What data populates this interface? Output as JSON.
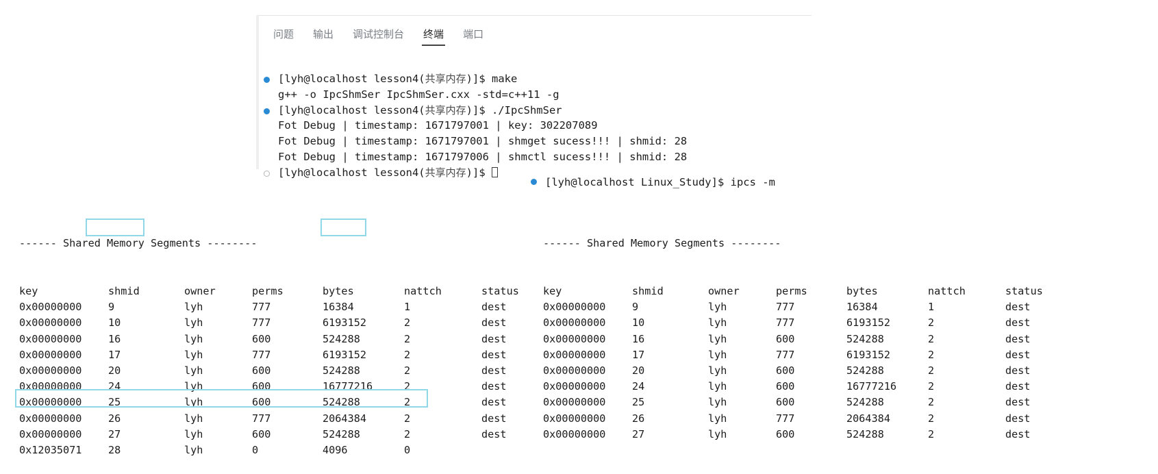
{
  "tabs": [
    {
      "label": "问题",
      "active": false
    },
    {
      "label": "输出",
      "active": false
    },
    {
      "label": "调试控制台",
      "active": false
    },
    {
      "label": "终端",
      "active": true
    },
    {
      "label": "端口",
      "active": false
    }
  ],
  "terminal": {
    "prompt_user_host": "[lyh@localhost ",
    "prompt_dir_1": "lesson4(共享内存)",
    "prompt_tail": ")]$ ",
    "lines": [
      {
        "bullet": "filled",
        "prompt": "[lyh@localhost lesson4(共享内存)]$ ",
        "command": "make"
      },
      {
        "bullet": "none",
        "prompt": "",
        "command": "g++ -o IpcShmSer IpcShmSer.cxx -std=c++11 -g"
      },
      {
        "bullet": "filled",
        "prompt": "[lyh@localhost lesson4(共享内存)]$ ",
        "command": "./IpcShmSer"
      },
      {
        "bullet": "none",
        "prompt": "",
        "command": "Fot Debug | timestamp: 1671797001 | key: 302207089"
      },
      {
        "bullet": "none",
        "prompt": "",
        "command": "Fot Debug | timestamp: 1671797001 | shmget sucess!!! | shmid: 28"
      },
      {
        "bullet": "none",
        "prompt": "",
        "command": "Fot Debug | timestamp: 1671797006 | shmctl sucess!!! | shmid: 28"
      },
      {
        "bullet": "hollow",
        "prompt": "[lyh@localhost lesson4(共享内存)]$ ",
        "command": ""
      }
    ],
    "second_prompt": {
      "bullet": "filled",
      "prompt": "[lyh@localhost Linux_Study]$ ",
      "command": "ipcs -m"
    }
  },
  "ipcs_left": {
    "title": "------ Shared Memory Segments --------",
    "headers": [
      "key",
      "shmid",
      "owner",
      "perms",
      "bytes",
      "nattch",
      "status"
    ],
    "rows": [
      [
        "0x00000000",
        "9",
        "lyh",
        "777",
        "16384",
        "1",
        "dest"
      ],
      [
        "0x00000000",
        "10",
        "lyh",
        "777",
        "6193152",
        "2",
        "dest"
      ],
      [
        "0x00000000",
        "16",
        "lyh",
        "600",
        "524288",
        "2",
        "dest"
      ],
      [
        "0x00000000",
        "17",
        "lyh",
        "777",
        "6193152",
        "2",
        "dest"
      ],
      [
        "0x00000000",
        "20",
        "lyh",
        "600",
        "524288",
        "2",
        "dest"
      ],
      [
        "0x00000000",
        "24",
        "lyh",
        "600",
        "16777216",
        "2",
        "dest"
      ],
      [
        "0x00000000",
        "25",
        "lyh",
        "600",
        "524288",
        "2",
        "dest"
      ],
      [
        "0x00000000",
        "26",
        "lyh",
        "777",
        "2064384",
        "2",
        "dest"
      ],
      [
        "0x00000000",
        "27",
        "lyh",
        "600",
        "524288",
        "2",
        "dest"
      ],
      [
        "0x12035071",
        "28",
        "lyh",
        "0",
        "4096",
        "0",
        ""
      ]
    ]
  },
  "ipcs_right": {
    "title": "------ Shared Memory Segments --------",
    "headers": [
      "key",
      "shmid",
      "owner",
      "perms",
      "bytes",
      "nattch",
      "status"
    ],
    "rows": [
      [
        "0x00000000",
        "9",
        "lyh",
        "777",
        "16384",
        "1",
        "dest"
      ],
      [
        "0x00000000",
        "10",
        "lyh",
        "777",
        "6193152",
        "2",
        "dest"
      ],
      [
        "0x00000000",
        "16",
        "lyh",
        "600",
        "524288",
        "2",
        "dest"
      ],
      [
        "0x00000000",
        "17",
        "lyh",
        "777",
        "6193152",
        "2",
        "dest"
      ],
      [
        "0x00000000",
        "20",
        "lyh",
        "600",
        "524288",
        "2",
        "dest"
      ],
      [
        "0x00000000",
        "24",
        "lyh",
        "600",
        "16777216",
        "2",
        "dest"
      ],
      [
        "0x00000000",
        "25",
        "lyh",
        "600",
        "524288",
        "2",
        "dest"
      ],
      [
        "0x00000000",
        "26",
        "lyh",
        "777",
        "2064384",
        "2",
        "dest"
      ],
      [
        "0x00000000",
        "27",
        "lyh",
        "600",
        "524288",
        "2",
        "dest"
      ]
    ]
  },
  "annotations": {
    "highlight_color": "#8fd8e8",
    "boxes": [
      "shmid-header",
      "bytes-header",
      "new-segment-row"
    ]
  },
  "colors": {
    "bullet_active": "#2a8ad4",
    "bullet_idle": "#b8b8b8",
    "tab_active_text": "#29292b",
    "tab_idle_text": "#7a7f85",
    "text": "#1c1c1c"
  }
}
